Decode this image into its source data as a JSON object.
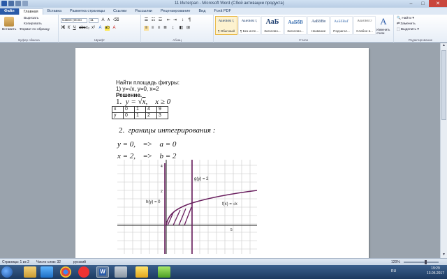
{
  "window": {
    "title": "11 Интеграл - Microsoft Word (Сбой активации продукта)"
  },
  "tabs": [
    "Файл",
    "Главная",
    "Вставка",
    "Разметка страницы",
    "Ссылки",
    "Рассылки",
    "Рецензирование",
    "Вид",
    "Foxit PDF"
  ],
  "ribbon": {
    "clipboard": {
      "paste": "Вставить",
      "cut": "Вырезать",
      "copy": "Копировать",
      "format_painter": "Формат по образцу",
      "label": "Буфер обмена"
    },
    "font": {
      "name": "Calibri (Осно",
      "size": "11",
      "label": "Шрифт"
    },
    "paragraph": {
      "label": "Абзац"
    },
    "styles": {
      "items": [
        {
          "sample": "АаБбВвГг,",
          "name": "¶ Обычный"
        },
        {
          "sample": "АаБбВвГг,",
          "name": "¶ Без инте..."
        },
        {
          "sample": "АаБ",
          "name": "Заголово..."
        },
        {
          "sample": "АаБбВ",
          "name": "Заголово..."
        },
        {
          "sample": "АаБбВв",
          "name": "Название"
        },
        {
          "sample": "АаБбВвГ",
          "name": "Подзагол..."
        },
        {
          "sample": "АаБбВвГг",
          "name": "Слабое в..."
        }
      ],
      "change": "Изменить стили",
      "label": "Стили"
    },
    "editing": {
      "find": "Найти",
      "replace": "Заменить",
      "select": "Выделить",
      "label": "Редактирование"
    }
  },
  "document": {
    "heading": "Найти площадь фигуры:",
    "problem": "1) y=√x, y=0, x=2",
    "solution": "Решение.",
    "step1": "1.",
    "table": {
      "rows": [
        [
          "x",
          "0",
          "1",
          "4",
          "9"
        ],
        [
          "y",
          "0",
          "1",
          "2",
          "3"
        ]
      ]
    },
    "step2_number": "2.",
    "step2": "границы интегрирования :",
    "limits": [
      {
        "left": "y = 0,",
        "arrow": "=>",
        "right": "a = 0"
      },
      {
        "left": "x = 2,",
        "arrow": "=>",
        "right": "b = 2"
      }
    ],
    "graph": {
      "label_g": "g(y) = 2",
      "label_h": "h(y) = 0",
      "label_f": "f(x) =",
      "tick_y": "4",
      "tick_y2": "2",
      "tick_x": "5"
    }
  },
  "statusbar": {
    "page": "Страница: 1 из 2",
    "words": "Число слов: 32",
    "lang": "русский",
    "zoom": "120%"
  },
  "taskbar": {
    "lang": "RU",
    "time": "19:29",
    "date": "13.05.2017"
  }
}
